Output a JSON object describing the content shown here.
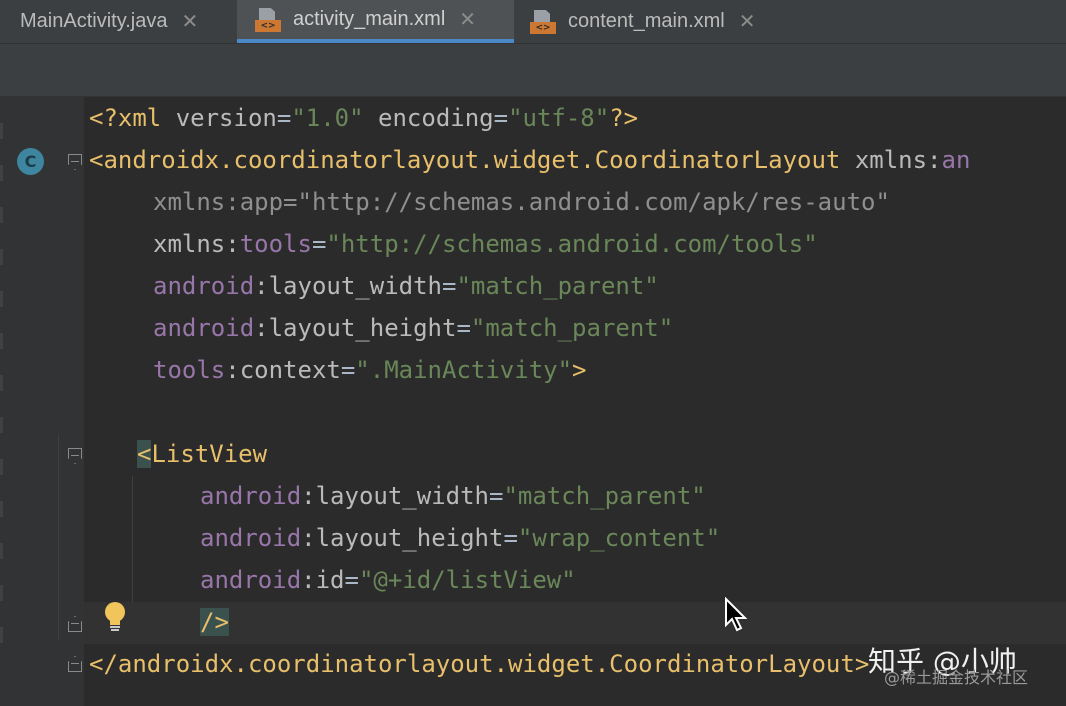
{
  "tabs": [
    {
      "label": "MainActivity.java",
      "close": "✕"
    },
    {
      "label": "activity_main.xml",
      "close": "✕",
      "badge": "<>"
    },
    {
      "label": "content_main.xml",
      "close": "✕",
      "badge": "<>"
    }
  ],
  "gutter": {
    "class_marker": "C"
  },
  "colors": {
    "tag": "#e8bf6a",
    "namespace": "#9876aa",
    "attribute": "#bababa",
    "string": "#6a8759",
    "text": "#a9b7c6",
    "background": "#2b2b2b"
  },
  "icons": [
    "java-file-icon",
    "xml-file-icon",
    "class-icon",
    "fold-icon",
    "bulb-icon",
    "mouse-cursor-icon"
  ],
  "code": {
    "l1": {
      "a": "<?xml ",
      "b": "version",
      "c": "=",
      "d": "\"1.0\"",
      "e": " ",
      "f": "encoding",
      "g": "=",
      "h": "\"utf-8\"",
      "i": "?>"
    },
    "l2": {
      "a": "<androidx.coordinatorlayout.widget.CoordinatorLayout ",
      "b": "xmlns:",
      "c": "an"
    },
    "l3": {
      "a": "xmlns:app",
      "b": "=",
      "c": "\"http://schemas.android.com/apk/res-auto\""
    },
    "l4": {
      "a": "xmlns:",
      "b": "tools",
      "c": "=",
      "d": "\"http://schemas.android.com/tools\""
    },
    "l5": {
      "a": "android",
      "b": ":layout_width",
      "c": "=",
      "d": "\"match_parent\""
    },
    "l6": {
      "a": "android",
      "b": ":layout_height",
      "c": "=",
      "d": "\"match_parent\""
    },
    "l7": {
      "a": "tools",
      "b": ":context",
      "c": "=",
      "d": "\".MainActivity\"",
      "e": ">"
    },
    "l9": {
      "a": "<",
      "b": "ListView"
    },
    "l10": {
      "a": "android",
      "b": ":layout_width",
      "c": "=",
      "d": "\"match_parent\""
    },
    "l11": {
      "a": "android",
      "b": ":layout_height",
      "c": "=",
      "d": "\"wrap_content\""
    },
    "l12": {
      "a": "android",
      "b": ":id",
      "c": "=",
      "d": "\"@+id/listView\""
    },
    "l13": {
      "a": "/>"
    },
    "l14": {
      "a": "</androidx.coordinatorlayout.widget.CoordinatorLa",
      "b": "yout>"
    }
  },
  "watermark": {
    "main": "知乎 @小帅",
    "sub": "@稀土掘金技术社区"
  }
}
